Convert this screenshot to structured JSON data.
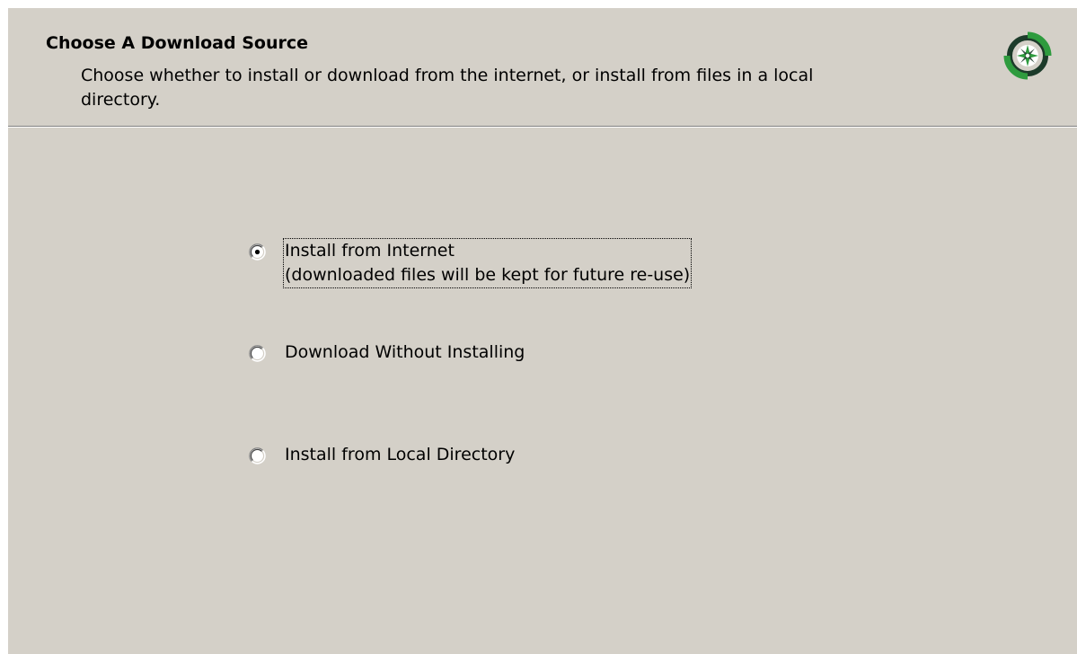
{
  "header": {
    "title": "Choose A Download Source",
    "subtitle": "Choose whether to install or download from the internet, or install from files in a local directory.",
    "icon": "compass-logo-icon"
  },
  "options": [
    {
      "label_line1": "Install from Internet",
      "label_line2": "(downloaded files will be kept for future re-use)",
      "selected": true,
      "focused": true
    },
    {
      "label": "Download Without Installing",
      "selected": false
    },
    {
      "label": "Install from Local Directory",
      "selected": false
    }
  ],
  "colors": {
    "dialog_background": "#d4d0c8",
    "icon_green": "#2e9b3e",
    "icon_dark": "#1c3b2a"
  }
}
